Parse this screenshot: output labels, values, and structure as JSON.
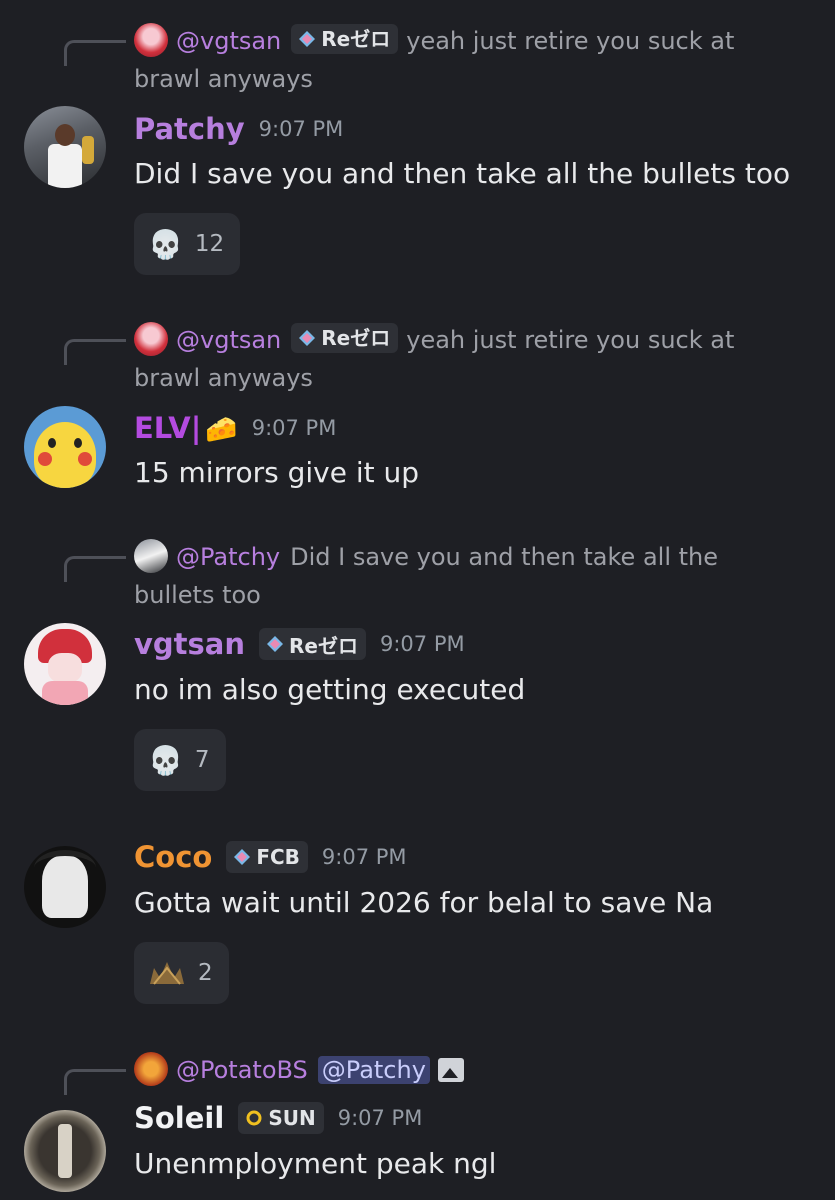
{
  "colors": {
    "background": "#1e1f24",
    "patchy": "#b77fde",
    "elv": "#b44be0",
    "vgtsan": "#b77fde",
    "coco": "#f09433",
    "soleil": "#f2f3f5",
    "mention_bg": "#3c4270"
  },
  "messages": [
    {
      "reply": {
        "username": "@vgtsan",
        "tag": "Reゼロ",
        "text": "yeah just retire you suck at brawl anyways"
      },
      "username": "Patchy",
      "time": "9:07 PM",
      "content": "Did I save you and then take all the bullets too",
      "reaction": {
        "emoji": "💀",
        "count": "12"
      }
    },
    {
      "reply": {
        "username": "@vgtsan",
        "tag": "Reゼロ",
        "text": "yeah just retire you suck at brawl anyways"
      },
      "username": "ELV|",
      "username_emoji": "🧀",
      "time": "9:07 PM",
      "content": "15 mirrors give it up"
    },
    {
      "reply": {
        "username": "@Patchy",
        "text": "Did I save you and then take all the bullets too"
      },
      "username": "vgtsan",
      "tag": "Reゼロ",
      "time": "9:07 PM",
      "content": "no im also getting executed",
      "reaction": {
        "emoji": "💀",
        "count": "7"
      }
    },
    {
      "username": "Coco",
      "tag": "FCB",
      "time": "9:07 PM",
      "content": "Gotta wait until 2026 for belal to save Na",
      "reaction": {
        "emoji": "custom-crown-emoji",
        "count": "2"
      }
    },
    {
      "reply": {
        "username": "@PotatoBS",
        "mention": "@Patchy",
        "icon": "image-icon"
      },
      "username": "Soleil",
      "tag": "SUN",
      "time": "9:07 PM",
      "content": "Unenmployment peak ngl"
    }
  ]
}
